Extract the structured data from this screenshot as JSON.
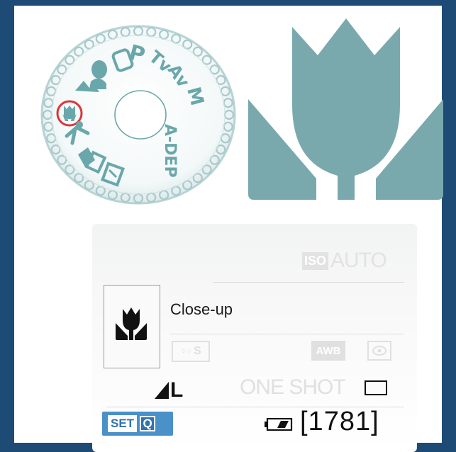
{
  "colors": {
    "background": "#1e4b75",
    "dial_teal": "#6aa7ab",
    "tulip_teal": "#7aa9ad",
    "highlight_red": "#d9363b",
    "set_blue": "#4a90c9"
  },
  "dial": {
    "labels": [
      "P",
      "Tv",
      "Av",
      "M",
      "A-DEP"
    ],
    "icons": [
      "portrait-icon",
      "camera-icon",
      "landscape-icon",
      "close-up-icon",
      "sports-icon",
      "night-portrait-icon",
      "flash-off-icon"
    ],
    "selected": "close-up-icon"
  },
  "big_icon": "close-up-tulip-icon",
  "lcd": {
    "iso_box": "ISO",
    "iso_value": "AUTO",
    "scene_icon": "close-up-icon",
    "mode_name": "Close-up",
    "picture_style": "S",
    "white_balance": "AWB",
    "metering_icon": "evaluative-metering-icon",
    "quality": "L",
    "af_mode": "ONE SHOT",
    "drive_icon": "single-shot-icon",
    "set_label": "SET",
    "q_label": "Q",
    "battery_icon": "battery-icon",
    "shots_remaining": "[1781]"
  }
}
